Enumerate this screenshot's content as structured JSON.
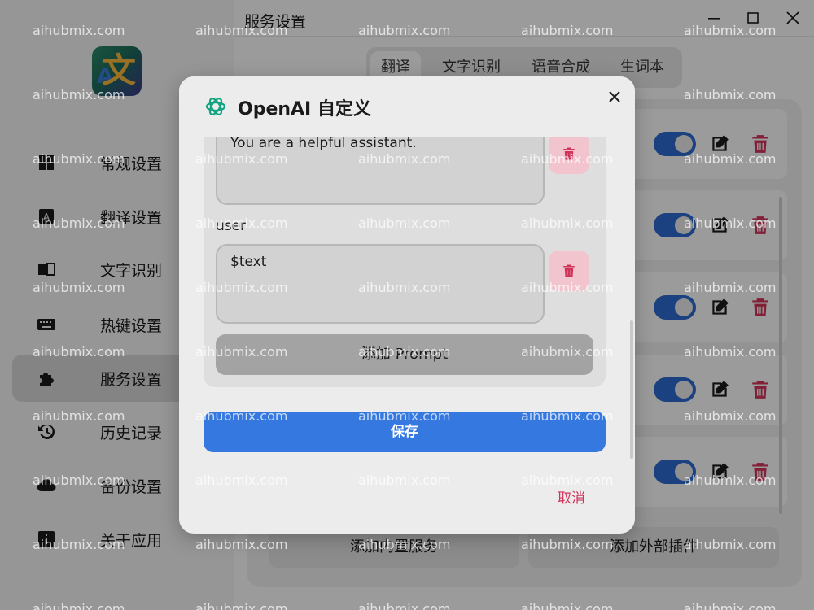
{
  "window": {
    "title": "服务设置"
  },
  "sidebar": {
    "items": [
      {
        "label": "常规设置"
      },
      {
        "label": "翻译设置"
      },
      {
        "label": "文字识别"
      },
      {
        "label": "热键设置"
      },
      {
        "label": "服务设置",
        "active": true
      },
      {
        "label": "历史记录"
      },
      {
        "label": "备份设置"
      },
      {
        "label": "关于应用"
      }
    ]
  },
  "tabs": [
    {
      "label": "翻译",
      "active": true
    },
    {
      "label": "文字识别"
    },
    {
      "label": "语音合成"
    },
    {
      "label": "生词本"
    }
  ],
  "services": {
    "rows": [
      {
        "enabled": true
      },
      {
        "enabled": true
      },
      {
        "enabled": true
      },
      {
        "enabled": true
      },
      {
        "enabled": true
      }
    ],
    "add_builtin_label": "添加内置服务",
    "add_external_label": "添加外部插件"
  },
  "dialog": {
    "title": "OpenAI 自定义",
    "prompts": [
      {
        "role": "",
        "content": "You are a helpful assistant."
      },
      {
        "role": "user",
        "content": "$text"
      }
    ],
    "add_prompt_label": "添加 Prompt",
    "save_label": "保存",
    "cancel_label": "取消"
  },
  "colors": {
    "accent": "#3578e0",
    "toggle_on": "#2e6ad1",
    "danger": "#d0345a",
    "openai_green": "#10a37f"
  },
  "watermark": {
    "text": "aihubmix.com"
  }
}
